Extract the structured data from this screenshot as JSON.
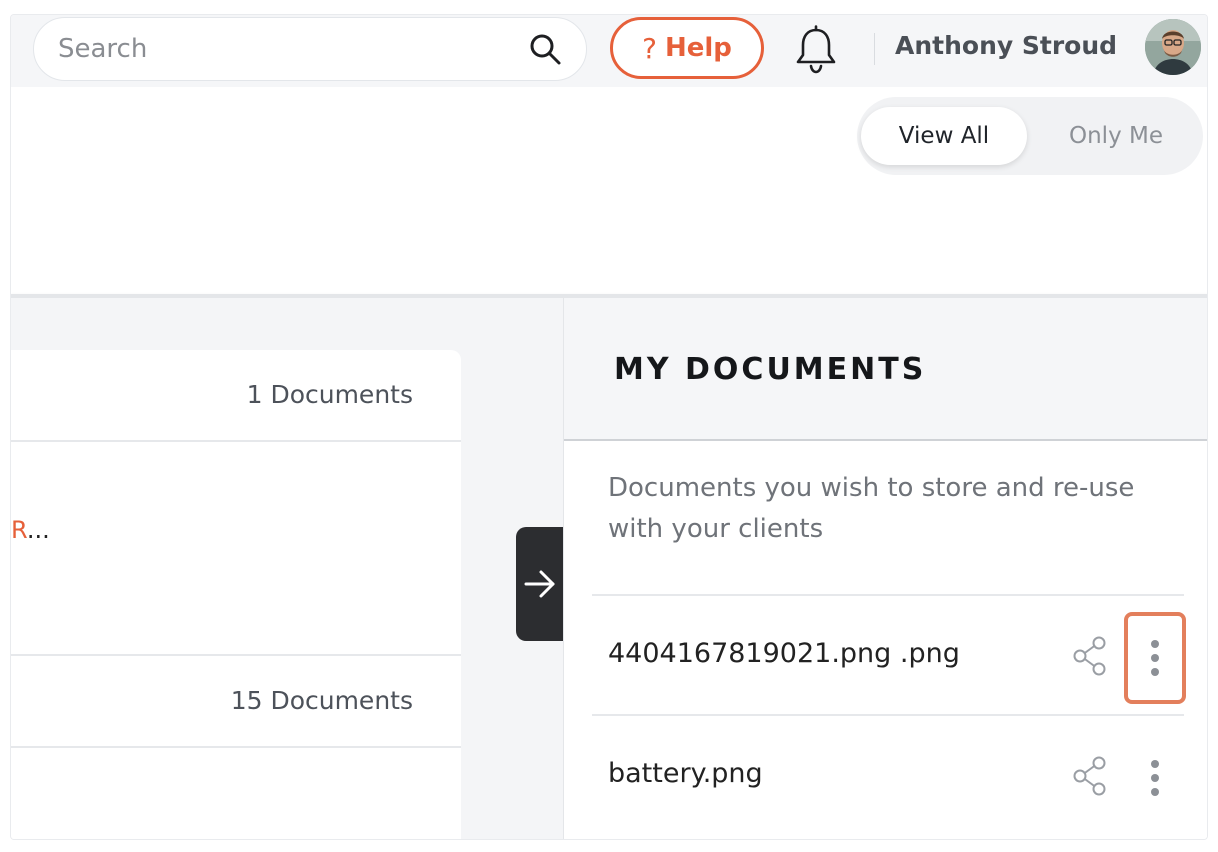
{
  "header": {
    "search_placeholder": "Search",
    "help_label": "Help",
    "help_glyph": "?",
    "user_name": "Anthony Stroud"
  },
  "filter": {
    "options": [
      "View All",
      "Only Me"
    ],
    "selected": "View All"
  },
  "left": {
    "groups": [
      {
        "count_label": "1 Documents",
        "snippet_prefix": "R",
        "snippet_suffix": "..."
      },
      {
        "count_label": "15 Documents"
      }
    ]
  },
  "panel": {
    "title": "MY DOCUMENTS",
    "description": "Documents you wish to store and re-use with your clients",
    "documents": [
      {
        "name": "4404167819021.png .png",
        "highlighted": true
      },
      {
        "name": "battery.png",
        "highlighted": false
      }
    ]
  },
  "icons": {
    "search": "search-icon",
    "bell": "bell-icon",
    "arrow": "arrow-right-icon",
    "share": "share-icon",
    "more": "more-vertical-icon"
  },
  "colors": {
    "accent": "#e6603a",
    "highlight_border": "#e37f5c",
    "collapse_tab": "#2c2d30"
  }
}
